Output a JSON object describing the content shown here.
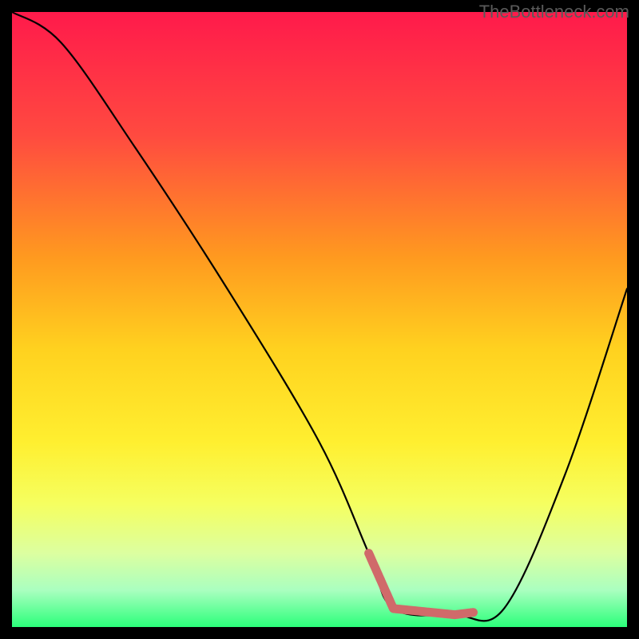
{
  "watermark": "TheBottleneck.com",
  "chart_data": {
    "type": "line",
    "title": "",
    "xlabel": "",
    "ylabel": "",
    "xlim": [
      0,
      100
    ],
    "ylim": [
      0,
      100
    ],
    "series": [
      {
        "name": "curve",
        "x": [
          0,
          8,
          20,
          35,
          50,
          58,
          62,
          72,
          80,
          90,
          100
        ],
        "y": [
          100,
          95,
          78,
          55,
          30,
          12,
          3,
          2,
          3,
          25,
          55
        ]
      }
    ],
    "highlight": {
      "x_start": 58,
      "x_end": 75,
      "color": "#d06a6a"
    },
    "background_gradient": {
      "stops": [
        {
          "pct": 0,
          "color": "#ff1a4b"
        },
        {
          "pct": 20,
          "color": "#ff4a40"
        },
        {
          "pct": 40,
          "color": "#ff9a1f"
        },
        {
          "pct": 55,
          "color": "#ffd21f"
        },
        {
          "pct": 70,
          "color": "#ffef30"
        },
        {
          "pct": 80,
          "color": "#f5ff60"
        },
        {
          "pct": 88,
          "color": "#dcffa0"
        },
        {
          "pct": 94,
          "color": "#aaffc0"
        },
        {
          "pct": 100,
          "color": "#2bff7a"
        }
      ]
    }
  }
}
